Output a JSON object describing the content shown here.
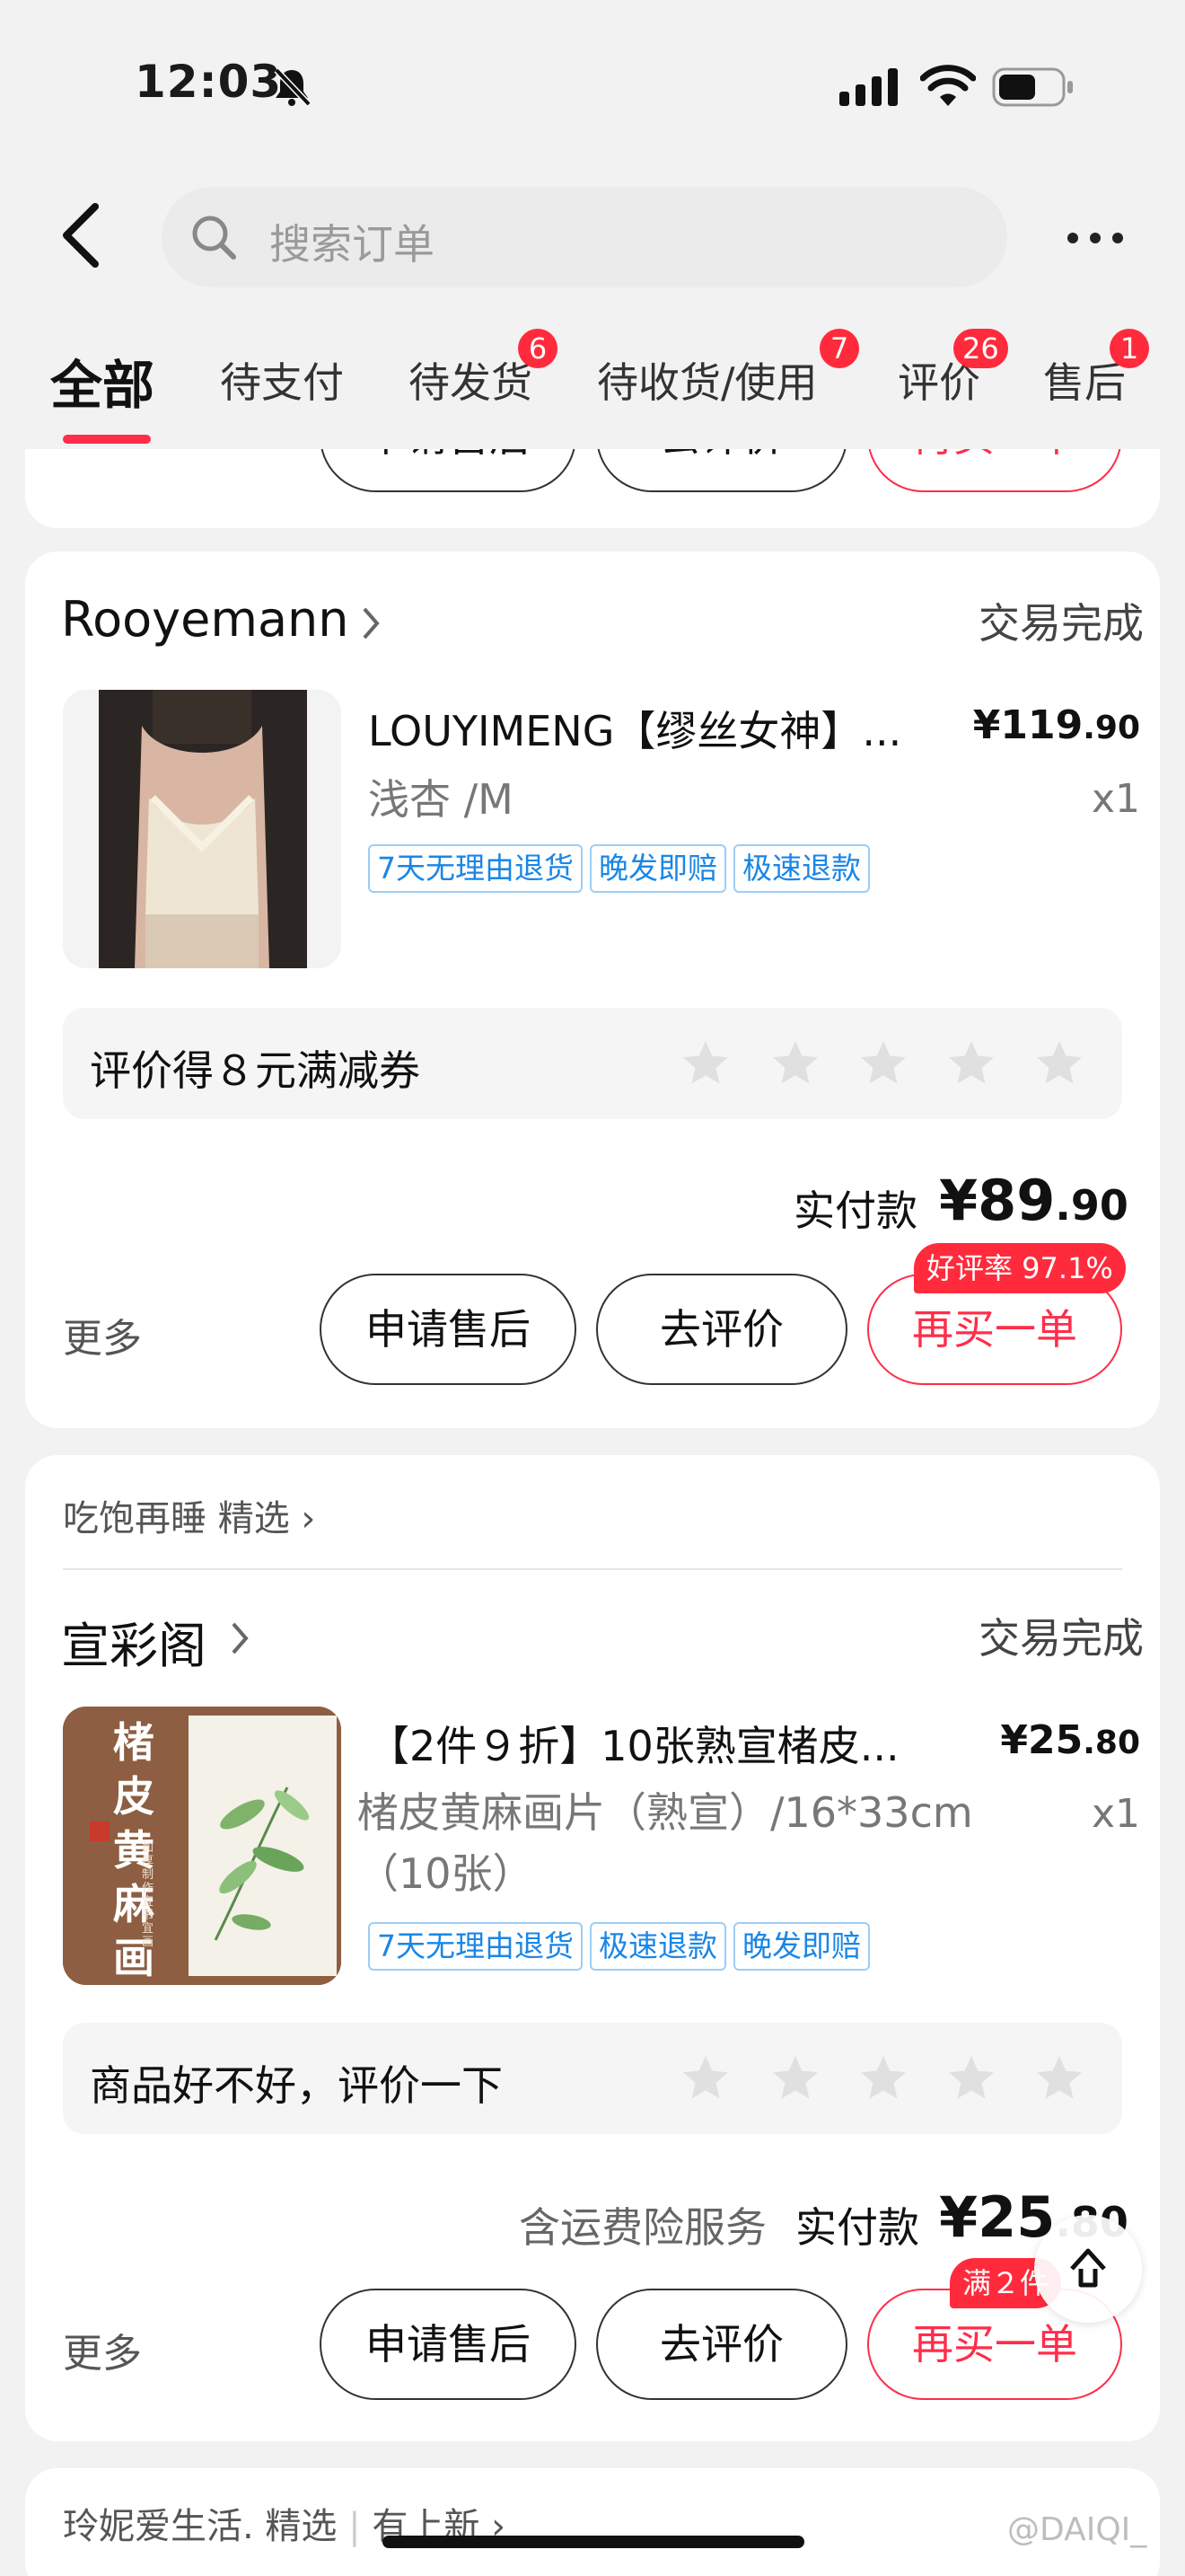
{
  "status_bar": {
    "time": "12:03"
  },
  "header": {
    "search_placeholder": "搜索订单"
  },
  "tabs": [
    {
      "label": "全部",
      "badge": ""
    },
    {
      "label": "待支付",
      "badge": ""
    },
    {
      "label": "待发货",
      "badge": "6"
    },
    {
      "label": "待收货/使用",
      "badge": "7"
    },
    {
      "label": "评价",
      "badge": "26"
    },
    {
      "label": "售后",
      "badge": "1"
    }
  ],
  "orders": [
    {
      "shop": "Rooyemann",
      "status": "交易完成",
      "product_title": "LOUYIMENG【缪丝女神】...",
      "price_int": "¥119",
      "price_dec": ".90",
      "sku": "浅杏 /M",
      "qty": "x1",
      "tags": [
        "7天无理由退货",
        "晚发即赔",
        "极速退款"
      ],
      "review_prompt": "评价得８元满减券",
      "pay_label": "实付款",
      "pay_int": "¥89",
      "pay_dec": ".90",
      "more": "更多",
      "btn_after_sale": "申请售后",
      "btn_review": "去评价",
      "btn_rebuy": "再买一单",
      "float_tag": "好评率 97.1%"
    },
    {
      "source": "吃饱再睡 精选",
      "shop": "宣彩阁",
      "status": "交易完成",
      "product_title": "【2件９折】10张熟宣楮皮...",
      "price_int": "¥25",
      "price_dec": ".80",
      "sku": "楮皮黄麻画片（熟宣）/16*33cm（10张）",
      "qty": "x1",
      "tags": [
        "7天无理由退货",
        "极速退款",
        "晚发即赔"
      ],
      "thumb_text": "楮皮黄麻画片",
      "thumb_sub": "加厚制作 宜书宜画",
      "review_prompt": "商品好不好，评价一下",
      "shipping_note": "含运费险服务",
      "pay_label": "实付款",
      "pay_int": "¥25",
      "pay_dec": ".80",
      "more": "更多",
      "btn_after_sale": "申请售后",
      "btn_review": "去评价",
      "btn_rebuy": "再买一单",
      "float_tag": "满２件"
    }
  ],
  "prev_card": {
    "btn_after_sale": "申请售后",
    "btn_review": "去评价",
    "btn_rebuy": "再买一单"
  },
  "next_card": {
    "source": "玲妮爱生活. 精选",
    "source_extra": "有上新"
  },
  "watermark": "@DAIQI_",
  "colors": {
    "accent_red": "#ff2d4a",
    "badge_red": "#ff2b3c",
    "tag_blue": "#1a86e6"
  }
}
